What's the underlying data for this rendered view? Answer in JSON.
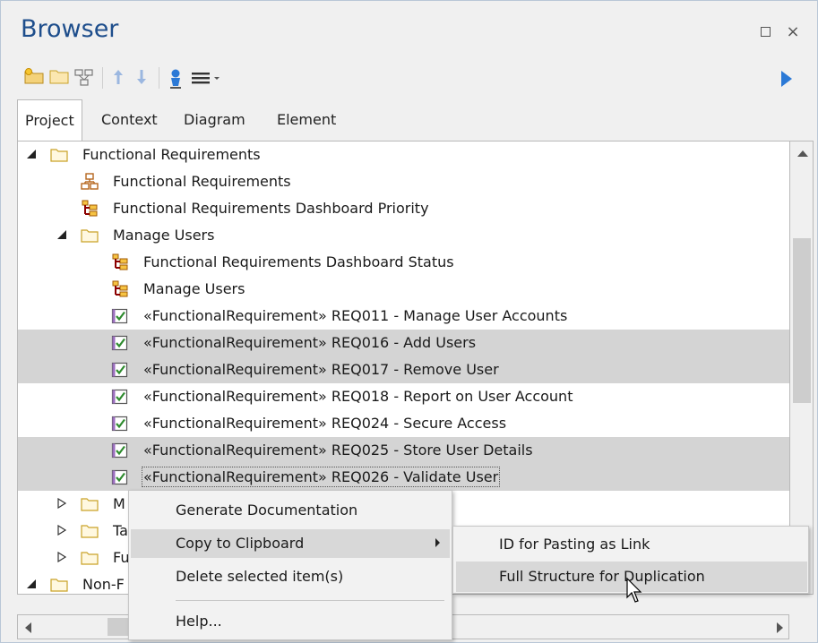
{
  "window": {
    "title": "Browser",
    "restore_icon": "restore-icon",
    "close_label": "×"
  },
  "toolbar": {
    "icons": [
      "new-package-icon",
      "folder-icon",
      "diagram-icon",
      "move-up-icon",
      "move-down-icon",
      "locate-icon",
      "menu-icon",
      "run-icon"
    ]
  },
  "tabs": [
    {
      "label": "Project",
      "active": true
    },
    {
      "label": "Context",
      "active": false
    },
    {
      "label": "Diagram",
      "active": false
    },
    {
      "label": "Element",
      "active": false
    }
  ],
  "tree": {
    "rows": [
      {
        "label": "Functional Requirements",
        "icon": "folder-icon",
        "expander": "expanded"
      },
      {
        "label": "Functional Requirements",
        "icon": "diagram-icon"
      },
      {
        "label": "Functional Requirements Dashboard Priority",
        "icon": "dashboard-icon"
      },
      {
        "label": "Manage Users",
        "icon": "folder-icon",
        "expander": "expanded"
      },
      {
        "label": "Functional Requirements Dashboard Status",
        "icon": "dashboard-icon"
      },
      {
        "label": "Manage Users",
        "icon": "dashboard-icon"
      },
      {
        "label": "«FunctionalRequirement» REQ011 - Manage User Accounts",
        "icon": "requirement-icon"
      },
      {
        "label": "«FunctionalRequirement» REQ016 - Add Users",
        "icon": "requirement-icon",
        "selected": true
      },
      {
        "label": "«FunctionalRequirement» REQ017 - Remove User",
        "icon": "requirement-icon",
        "selected": true
      },
      {
        "label": "«FunctionalRequirement» REQ018 - Report on User Account",
        "icon": "requirement-icon"
      },
      {
        "label": "«FunctionalRequirement» REQ024 - Secure Access",
        "icon": "requirement-icon"
      },
      {
        "label": "«FunctionalRequirement» REQ025 - Store User Details",
        "icon": "requirement-icon",
        "selected": true
      },
      {
        "label": "«FunctionalRequirement» REQ026 - Validate User",
        "icon": "requirement-icon",
        "selected": true,
        "focused": true
      },
      {
        "label": "M",
        "icon": "folder-icon",
        "expander": "collapsed"
      },
      {
        "label": "Ta",
        "icon": "folder-icon",
        "expander": "collapsed"
      },
      {
        "label": "Fu",
        "icon": "folder-icon",
        "expander": "collapsed"
      },
      {
        "label": "Non-F",
        "icon": "folder-icon",
        "expander": "expanded"
      }
    ]
  },
  "context_menu": {
    "items": [
      {
        "label": "Generate Documentation"
      },
      {
        "label": "Copy to Clipboard",
        "has_submenu": true,
        "highlighted": true
      },
      {
        "label": "Delete selected item(s)"
      },
      {
        "label": "Help..."
      }
    ]
  },
  "submenu": {
    "items": [
      {
        "label": "ID for Pasting as Link"
      },
      {
        "label": "Full Structure for Duplication",
        "highlighted": true
      }
    ]
  },
  "colors": {
    "title": "#1e4e8c",
    "selection": "#d4d4d4",
    "menu_hover": "#d8d8d8",
    "accent": "#2b79d6",
    "folder": "#c9a227",
    "requirement_check": "#2e8b2e"
  }
}
